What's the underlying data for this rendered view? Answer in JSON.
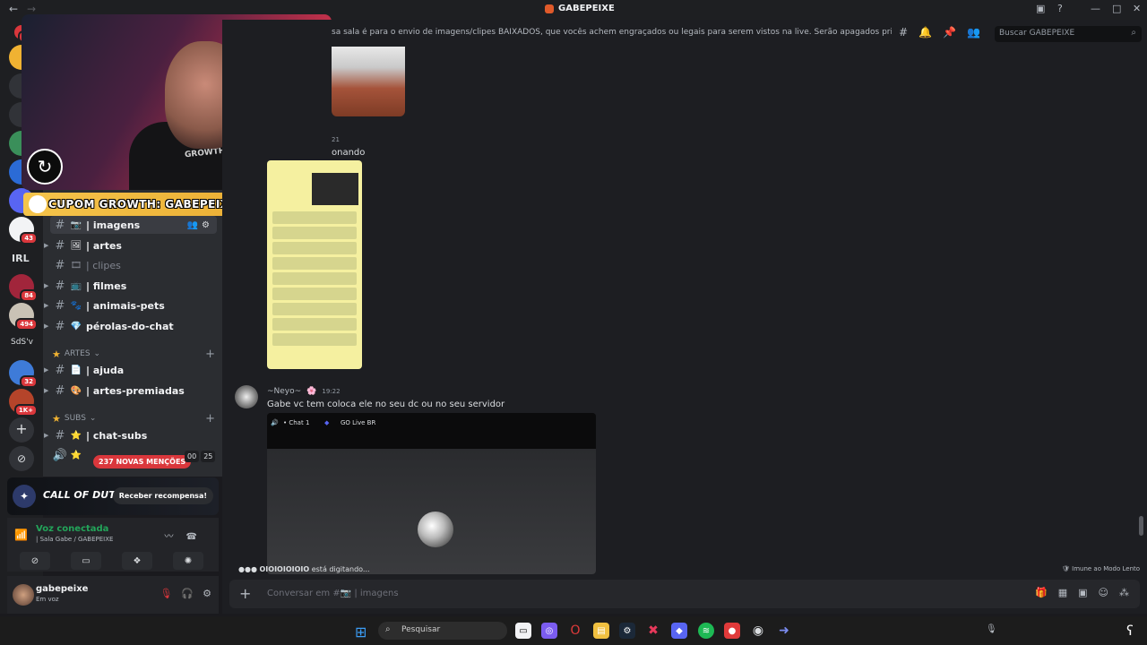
{
  "window": {
    "title": "GABEPEIXE"
  },
  "topic": "sa sala é para o envio de imagens/clipes BAIXADOS, que vocês achem engraçados ou legais para serem vistos na live. Serão apagados prints de outras rede...",
  "search": {
    "placeholder": "Buscar GABEPEIXE"
  },
  "servers": {
    "badges": [
      "NO",
      "2",
      "5",
      "43",
      "84",
      "494",
      "32",
      "1K+"
    ],
    "labels": [
      "IRL",
      "SdS'v"
    ]
  },
  "overlay": {
    "coupon": "CUPOM GROWTH: GABEPEIXE",
    "shirt_text": "GROWTH"
  },
  "channels": [
    {
      "name": "| imagens",
      "icon": "📷",
      "active": true
    },
    {
      "name": "| artes",
      "icon": "🖼",
      "active": false
    },
    {
      "name": "| clipes",
      "icon": "🎞",
      "active": false,
      "muted": true
    },
    {
      "name": "| filmes",
      "icon": "📺",
      "active": false
    },
    {
      "name": "| animais-pets",
      "icon": "🐾",
      "active": false
    },
    {
      "name": "pérolas-do-chat",
      "icon": "💎",
      "active": false
    }
  ],
  "categories": {
    "artes": "ARTES",
    "subs": "SUBS"
  },
  "artes_channels": [
    {
      "name": "| ajuda",
      "icon": "📄"
    },
    {
      "name": "| artes-premiadas",
      "icon": "🎨"
    }
  ],
  "subs_channels": [
    {
      "name": "| chat-subs",
      "icon": "⭐"
    }
  ],
  "mentions": "237 NOVAS MENÇÕES",
  "voice_counts": [
    "00",
    "25"
  ],
  "promo": {
    "brand": "CALL OF DUTY",
    "button": "Receber recompensa!"
  },
  "voice": {
    "status": "Voz conectada",
    "channel": "| Sala Gabe / GABEPEIXE"
  },
  "user": {
    "name": "gabepeixe",
    "status": "Em voz"
  },
  "messages": {
    "partial_time": "21",
    "partial_text": "onando",
    "author": "~Neyo~",
    "author_badge": "🌸",
    "time": "19:22",
    "text": "Gabe vc tem coloca ele no seu dc ou no seu servidor",
    "video_tab": "• Chat 1",
    "video_channel": "GO Live BR"
  },
  "typing": {
    "user": "OIOIOIOIOIO",
    "suffix": " está digitando..."
  },
  "slow_mode": "Imune ao Modo Lento",
  "composer": {
    "placeholder": "Conversar em #📷 | imagens"
  },
  "taskbar": {
    "search_placeholder": "Pesquisar"
  }
}
